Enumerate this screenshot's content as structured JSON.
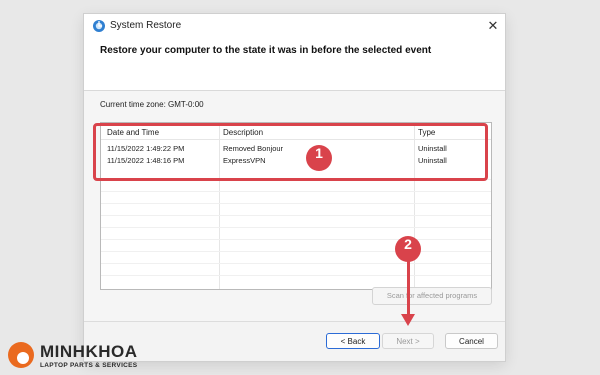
{
  "window": {
    "title": "System Restore",
    "close_glyph": "✕"
  },
  "heading": "Restore your computer to the state it was in before the selected event",
  "timezone": "Current time zone: GMT-0:00",
  "table": {
    "columns": [
      "Date and Time",
      "Description",
      "Type"
    ],
    "rows": [
      [
        "11/15/2022 1:49:22 PM",
        "Removed Bonjour",
        "Uninstall"
      ],
      [
        "11/15/2022 1:48:16 PM",
        "ExpressVPN",
        "Uninstall"
      ]
    ]
  },
  "scan_button": "Scan for affected programs",
  "buttons": {
    "back": "< Back",
    "next": "Next >",
    "cancel": "Cancel"
  },
  "annotations": {
    "badge1": "1",
    "badge2": "2",
    "color": "#d9434b"
  },
  "watermark": {
    "name": "MINHKHOA",
    "tagline": "LAPTOP PARTS & SERVICES",
    "color": "#ea6a1f"
  },
  "icons": {
    "app": "system-restore-icon",
    "close": "close-icon"
  }
}
